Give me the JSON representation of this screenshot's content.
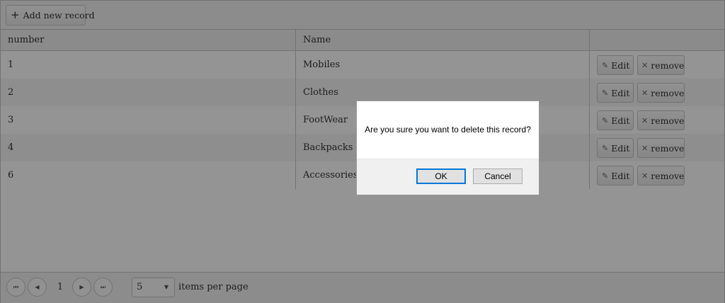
{
  "toolbar": {
    "add_label": "Add new record",
    "add_icon": "plus-icon"
  },
  "grid": {
    "columns": [
      "number",
      "Name",
      ""
    ],
    "rows": [
      {
        "number": "1",
        "name": "Mobiles"
      },
      {
        "number": "2",
        "name": "Clothes"
      },
      {
        "number": "3",
        "name": "FootWear"
      },
      {
        "number": "4",
        "name": "Backpacks"
      },
      {
        "number": "6",
        "name": "Accessories"
      }
    ],
    "edit_label": "Edit",
    "remove_label": "remove"
  },
  "pager": {
    "current_page": "1",
    "page_size": "5",
    "label": "items per page"
  },
  "dialog": {
    "message": "Are you sure you want to delete this record?",
    "ok_label": "OK",
    "cancel_label": "Cancel"
  }
}
